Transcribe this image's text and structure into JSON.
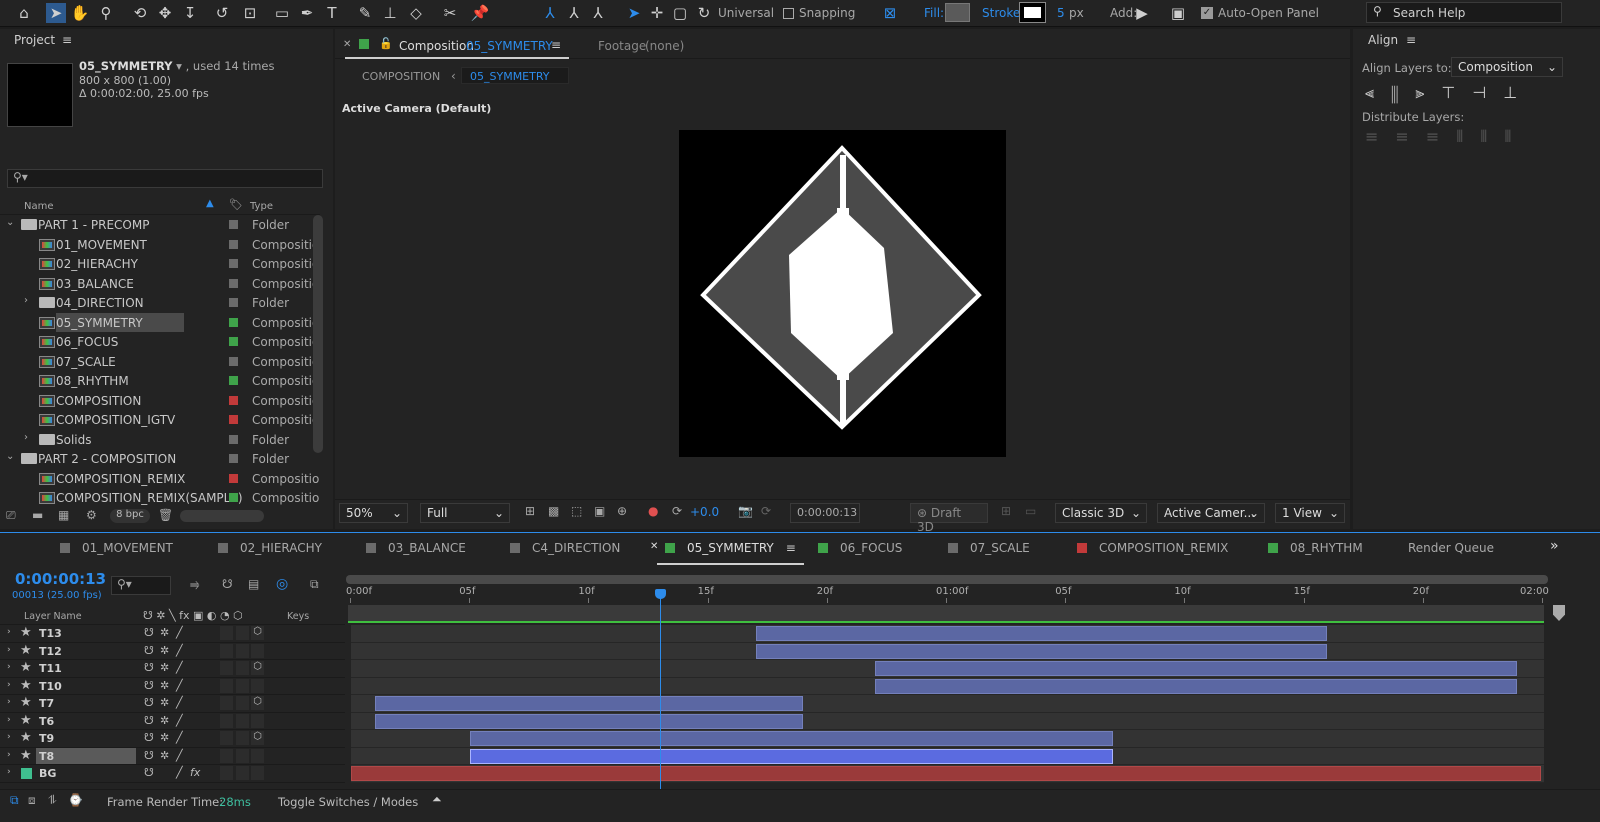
{
  "toolbar": {
    "universal": "Universal",
    "snapping": "Snapping",
    "fill": "Fill:",
    "stroke": "Stroke:",
    "stroke_px": "5",
    "px": "px",
    "add": "Add:",
    "auto_open": "Auto-Open Panel",
    "search_help": "Search Help"
  },
  "project": {
    "title": "Project",
    "comp_name": "05_SYMMETRY",
    "used": ", used 14 times",
    "size": "800 x 800  (1.00)",
    "duration": "Δ 0:00:02:00, 25.00 fps",
    "col_name": "Name",
    "col_type": "Type",
    "bpc": "8 bpc",
    "items": [
      {
        "name": "PART 1 - PRECOMP",
        "type": "Folder",
        "kind": "folder",
        "indent": 0,
        "color": "#6b6b6b",
        "expand": "v"
      },
      {
        "name": "01_MOVEMENT",
        "type": "Compositio",
        "kind": "comp",
        "indent": 1,
        "color": "#6b6b6b",
        "expand": ""
      },
      {
        "name": "02_HIERACHY",
        "type": "Compositio",
        "kind": "comp",
        "indent": 1,
        "color": "#6b6b6b",
        "expand": ""
      },
      {
        "name": "03_BALANCE",
        "type": "Compositio",
        "kind": "comp",
        "indent": 1,
        "color": "#6b6b6b",
        "expand": ""
      },
      {
        "name": "04_DIRECTION",
        "type": "Folder",
        "kind": "folder",
        "indent": 1,
        "color": "#6b6b6b",
        "expand": ">"
      },
      {
        "name": "05_SYMMETRY",
        "type": "Compositio",
        "kind": "comp",
        "indent": 1,
        "color": "#3fa34a",
        "expand": "",
        "selected": true
      },
      {
        "name": "06_FOCUS",
        "type": "Compositio",
        "kind": "comp",
        "indent": 1,
        "color": "#3fa34a",
        "expand": ""
      },
      {
        "name": "07_SCALE",
        "type": "Compositio",
        "kind": "comp",
        "indent": 1,
        "color": "#6b6b6b",
        "expand": ""
      },
      {
        "name": "08_RHYTHM",
        "type": "Compositio",
        "kind": "comp",
        "indent": 1,
        "color": "#3fa34a",
        "expand": ""
      },
      {
        "name": "COMPOSITION",
        "type": "Compositio",
        "kind": "comp",
        "indent": 1,
        "color": "#c23a3a",
        "expand": ""
      },
      {
        "name": "COMPOSITION_IGTV",
        "type": "Compositio",
        "kind": "comp",
        "indent": 1,
        "color": "#c23a3a",
        "expand": ""
      },
      {
        "name": "Solids",
        "type": "Folder",
        "kind": "folder",
        "indent": 1,
        "color": "#6b6b6b",
        "expand": ">"
      },
      {
        "name": "PART 2 - COMPOSITION",
        "type": "Folder",
        "kind": "folder",
        "indent": 0,
        "color": "#6b6b6b",
        "expand": "v"
      },
      {
        "name": "COMPOSITION_REMIX",
        "type": "Compositio",
        "kind": "comp",
        "indent": 1,
        "color": "#c23a3a",
        "expand": ""
      },
      {
        "name": "COMPOSITION_REMIX(SAMPLE)",
        "type": "Compositio",
        "kind": "comp",
        "indent": 1,
        "color": "#3fa34a",
        "expand": ""
      }
    ]
  },
  "comp": {
    "tab_label": "Composition",
    "tab_name": "05_SYMMETRY",
    "footage": "Footage",
    "footage_val": "(none)",
    "crumb1": "COMPOSITION",
    "crumb2": "05_SYMMETRY",
    "camera": "Active Camera (Default)",
    "zoom": "50%",
    "resolution": "Full",
    "exposure": "+0.0",
    "timecode": "0:00:00:13",
    "draft3d": "Draft 3D",
    "renderer": "Classic 3D",
    "view_camera": "Active Camer...",
    "views": "1 View"
  },
  "align": {
    "title": "Align",
    "align_to_label": "Align Layers to:",
    "align_to": "Composition",
    "distribute": "Distribute Layers:"
  },
  "timeline": {
    "tabs": [
      {
        "label": "01_MOVEMENT",
        "color": "#6b6b6b"
      },
      {
        "label": "02_HIERACHY",
        "color": "#6b6b6b"
      },
      {
        "label": "03_BALANCE",
        "color": "#6b6b6b"
      },
      {
        "label": "C4_DIRECTION",
        "color": "#6b6b6b"
      },
      {
        "label": "05_SYMMETRY",
        "color": "#3fa34a",
        "active": true
      },
      {
        "label": "06_FOCUS",
        "color": "#3fa34a"
      },
      {
        "label": "07_SCALE",
        "color": "#6b6b6b"
      },
      {
        "label": "COMPOSITION_REMIX",
        "color": "#c23a3a"
      },
      {
        "label": "08_RHYTHM",
        "color": "#3fa34a"
      }
    ],
    "render_queue": "Render Queue",
    "timecode": "0:00:00:13",
    "frames": "00013 (25.00 fps)",
    "layer_name": "Layer Name",
    "keys": "Keys",
    "ticks": [
      "0:00f",
      "05f",
      "10f",
      "15f",
      "20f",
      "01:00f",
      "05f",
      "10f",
      "15f",
      "20f",
      "02:00"
    ],
    "playhead_frame": 13,
    "total_frames": 50,
    "layers": [
      {
        "name": "T13",
        "start": 17,
        "end": 41,
        "color": "#5b67a3"
      },
      {
        "name": "T12",
        "start": 17,
        "end": 41,
        "color": "#5b67a3"
      },
      {
        "name": "T11",
        "start": 22,
        "end": 49,
        "color": "#5b67a3"
      },
      {
        "name": "T10",
        "start": 22,
        "end": 49,
        "color": "#5b67a3"
      },
      {
        "name": "T7",
        "start": 1,
        "end": 19,
        "color": "#5b67a3"
      },
      {
        "name": "T6",
        "start": 1,
        "end": 19,
        "color": "#5b67a3"
      },
      {
        "name": "T9",
        "start": 5,
        "end": 32,
        "color": "#5b67a3"
      },
      {
        "name": "T8",
        "start": 5,
        "end": 32,
        "color": "#5b6be0",
        "selected": true
      },
      {
        "name": "BG",
        "start": 0,
        "end": 50,
        "color": "#9a3a3a",
        "solid": true
      }
    ],
    "footer": {
      "frame_render": "Frame Render Time:",
      "render_ms": "28ms",
      "toggle": "Toggle Switches / Modes"
    }
  }
}
